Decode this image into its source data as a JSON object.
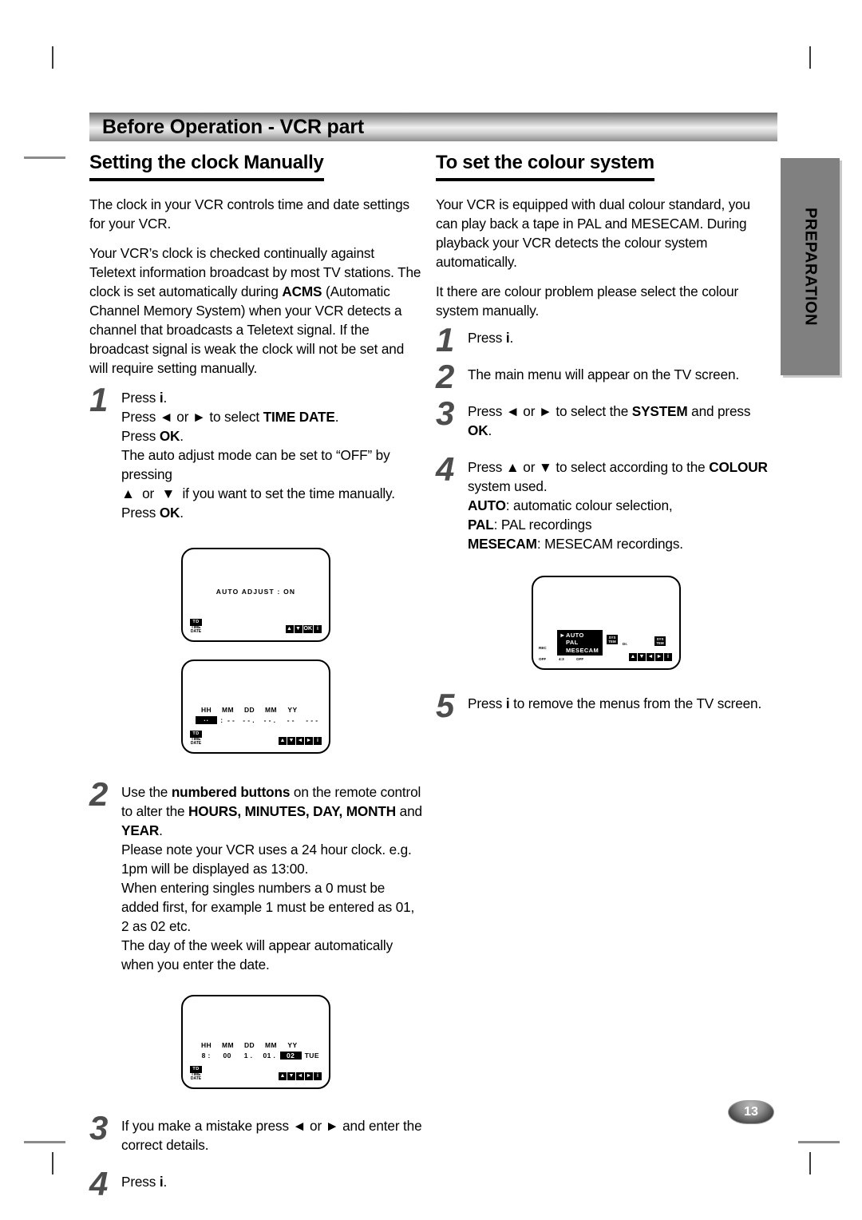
{
  "header": {
    "title": "Before Operation - VCR part"
  },
  "side_tab": {
    "label": "PREPARATION"
  },
  "page_number": "13",
  "left": {
    "heading": "Setting the clock Manually",
    "paragraphs": [
      "The clock in your VCR controls time and date settings for your VCR.",
      "Your VCR’s clock is checked continually against Teletext information broadcast by most TV stations. The clock is set automatically during ACMS (Automatic Channel Memory System) when your VCR detects a channel that broadcasts a Teletext signal. If the broadcast signal is weak the clock will not be set and will require setting manually."
    ],
    "steps": [
      {
        "num": "1",
        "lines": [
          "Press i.",
          "Press ◄ or ► to select TIME DATE.",
          "Press OK.",
          "The auto adjust mode can be set to “OFF” by pressing",
          "▲ or ▼ if you want to set the time manually.",
          "Press OK."
        ]
      },
      {
        "num": "2",
        "lines": [
          "Use the numbered buttons on the remote control to alter the HOURS, MINUTES, DAY, MONTH and YEAR.",
          "Please note your VCR uses a 24 hour clock. e.g. 1pm will be displayed as 13:00.",
          "When entering singles numbers a 0 must be added first, for example 1 must be entered as 01, 2 as 02 etc.",
          "The day of the week will appear automatically when you enter the date."
        ]
      },
      {
        "num": "3",
        "lines": [
          "If you make a mistake  press ◄ or ► and enter the correct details."
        ]
      },
      {
        "num": "4",
        "lines": [
          "Press i."
        ]
      }
    ],
    "screens": [
      {
        "id": "auto-adjust-screen",
        "center_text": "AUTO   ADJUST  :  ON",
        "badge": {
          "top": "TD",
          "line1": "TIME",
          "line2": "DATE"
        },
        "keys": [
          "▲",
          "▼",
          "OK",
          "i"
        ]
      },
      {
        "id": "time-date-empty-screen",
        "headers": [
          "HH",
          "MM",
          "DD",
          "MM",
          "YY"
        ],
        "values": [
          "",
          ":  - -",
          "- - .",
          "- - .",
          "- -",
          "- - -"
        ],
        "cursor": "··",
        "badge": {
          "top": "TD",
          "line1": "TIME",
          "line2": "DATE"
        },
        "keys": [
          "▲",
          "▼",
          "◄",
          "►",
          "i"
        ]
      },
      {
        "id": "time-date-filled-screen",
        "headers": [
          "HH",
          "MM",
          "DD",
          "MM",
          "YY"
        ],
        "values": [
          "8 :",
          "00",
          "1 .",
          "01 .",
          "02",
          "TUE"
        ],
        "highlight_value": "02",
        "badge": {
          "top": "TD",
          "line1": "TIME",
          "line2": "DATE"
        },
        "keys": [
          "▲",
          "▼",
          "◄",
          "►",
          "i"
        ]
      }
    ]
  },
  "right": {
    "heading": "To set the colour system",
    "paragraphs": [
      "Your VCR is equipped with dual colour standard, you can play back a tape in PAL and MESECAM. During playback your VCR detects the colour system automatically.",
      "It there are colour problem please select the colour system manually."
    ],
    "steps": [
      {
        "num": "1",
        "lines": [
          "Press i."
        ]
      },
      {
        "num": "2",
        "lines": [
          "The main menu will appear on the TV screen."
        ]
      },
      {
        "num": "3",
        "lines": [
          "Press ◄ or ► to select the SYSTEM and press OK."
        ]
      },
      {
        "num": "4",
        "lines": [
          "Press ▲ or ▼ to select according to the COLOUR system used.",
          "AUTO: automatic colour selection,",
          "PAL: PAL recordings",
          "MESECAM: MESECAM recordings."
        ]
      },
      {
        "num": "5",
        "lines": [
          "Press i to remove the menus from the TV screen."
        ]
      }
    ],
    "screen": {
      "id": "colour-system-screen",
      "menu_items": [
        "AUTO",
        "PAL",
        "MESECAM"
      ],
      "selected": "AUTO",
      "selector_glyph": "►",
      "side_labels": [
        "REC",
        "OFF",
        "4:3",
        "OFF"
      ],
      "icon_labels": [
        "SYS TEM",
        "Dr.",
        "SYS TEM"
      ],
      "keys": [
        "▲",
        "▼",
        "◄",
        "►",
        "i"
      ]
    }
  }
}
